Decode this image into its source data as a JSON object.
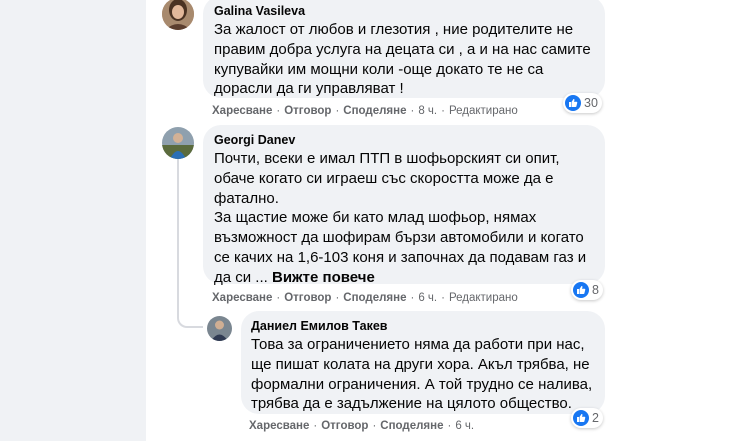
{
  "comments": [
    {
      "author": "Galina Vasileva",
      "lines": [
        "За жалост от любов и глезотия , ние родителите не",
        "правим добра услуга на децата си , а и на нас самите",
        "купувайки им мощни коли -още докато те не са",
        "дорасли да ги управляват !"
      ],
      "actions": {
        "like": "Харесване",
        "reply": "Отговор",
        "share": "Споделяне",
        "time": "8 ч.",
        "edited": "Редактирано"
      },
      "reactions": {
        "icon": "like-icon",
        "count": "30"
      }
    },
    {
      "author": "Georgi Danev",
      "lines": [
        "Почти, всеки е имал ПТП в шофьорският си опит,",
        "обаче когато си играеш със скоростта може да е",
        "фатално.",
        "За щастие може би като млад шофьор, нямах",
        "възможност да шофирам бързи автомобили и когато",
        "се качих на 1,6-103 коня и започнах да подавам газ и"
      ],
      "last_line": "да си ...",
      "see_more": "Вижте повече",
      "actions": {
        "like": "Харесване",
        "reply": "Отговор",
        "share": "Споделяне",
        "time": "6 ч.",
        "edited": "Редактирано"
      },
      "reactions": {
        "icon": "like-icon",
        "count": "8"
      }
    },
    {
      "author": "Даниел Емилов Такев",
      "lines": [
        "Това за ограничението няма да работи при нас,",
        "ще пишат колата на други хора. Акъл трябва, не",
        "формални ограничения. А той трудно се налива,",
        "трябва да е задължение на цялото общество."
      ],
      "actions": {
        "like": "Харесване",
        "reply": "Отговор",
        "share": "Споделяне",
        "time": "6 ч."
      },
      "reactions": {
        "icon": "like-icon",
        "count": "2"
      }
    }
  ],
  "colors": {
    "page_bg": "#f0f2f5",
    "bubble_bg": "#f0f2f5",
    "meta_text": "#65676b",
    "like_blue": "#1877f2"
  }
}
